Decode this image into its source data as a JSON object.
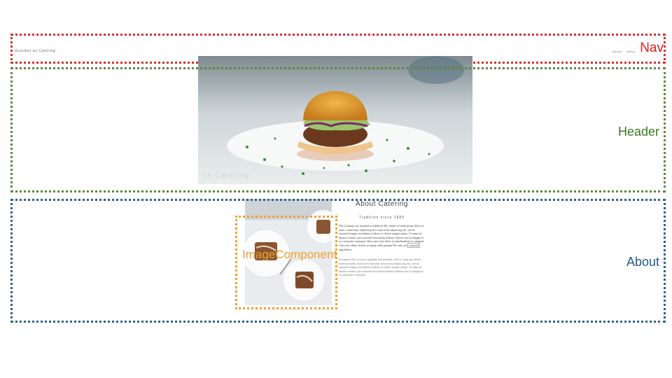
{
  "nav": {
    "brand": "Gourmet au Catering",
    "links": [
      "About",
      "Menu"
    ],
    "label": "Nav"
  },
  "header": {
    "caption": "Le Catering",
    "label": "Header"
  },
  "about": {
    "label": "About",
    "image_label": "ImageComponent",
    "title": "About Catering",
    "subtitle": "Tradition since 1889",
    "p1_before": "The Catering was founded in blabla by Mr. Smith in lorem ipsum dolor sit amet, consectetur adipiscing elit consectetur adipiscing elit, sed do eiusmod tempor incididunt ut labore et dolore magna aliqua. Ut enim ad minim veniam, quis nostrud exercitation ullamco laboris nisi ut aliquip ex ea commodo consequat. Duis aute irure dolor in reprehenderit in voluptate velit esse cillum dolore eu fugiat nulla pariatur.We only use",
    "p1_highlight": "seasonal",
    "p1_after": "ingredients.",
    "p2": "Excepteur sint occaecat cupidatat non proident, sunt in culpa qui officia deserunt mollit anim id est laborum consectetur adipiscing elit, sed do eiusmod tempor incididunt ut labore et dolore magna aliqua. Ut enim ad minim veniam, quis nostrud exercitation ullamco laboris nisi ut aliquip ex ea commodo consequat."
  },
  "colors": {
    "nav": "#d03030",
    "header": "#5a8a3a",
    "about": "#2f5f8f",
    "image": "#f0a030"
  }
}
